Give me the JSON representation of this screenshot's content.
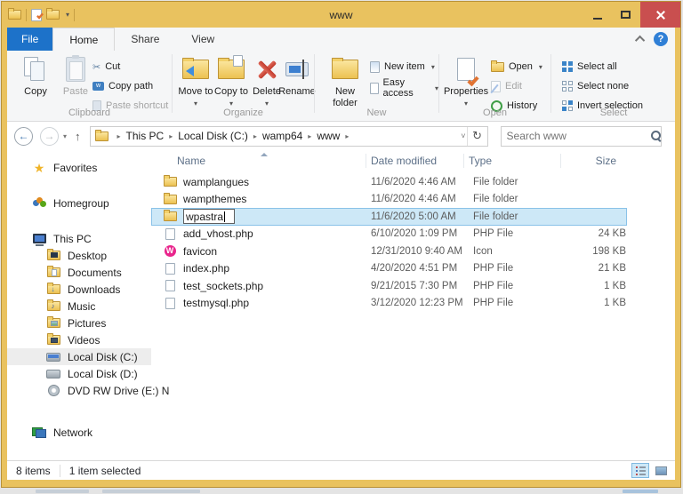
{
  "window": {
    "title": "www",
    "tabs": {
      "file": "File",
      "home": "Home",
      "share": "Share",
      "view": "View"
    }
  },
  "colors": {
    "titlebar_gold": "#e9c25f",
    "file_tab_blue": "#1d72c9",
    "selection_fill": "#cde8f7",
    "selection_border": "#8ac2e8",
    "close_button_red": "#c94f4f"
  },
  "ribbon": {
    "clipboard": {
      "label": "Clipboard",
      "copy": "Copy",
      "paste": "Paste",
      "cut": "Cut",
      "copy_path": "Copy path",
      "paste_shortcut": "Paste shortcut"
    },
    "organize": {
      "label": "Organize",
      "move_to": "Move to",
      "copy_to": "Copy to",
      "delete": "Delete",
      "rename": "Rename"
    },
    "new_group": {
      "label": "New",
      "new_folder": "New folder",
      "new_item": "New item",
      "easy_access": "Easy access"
    },
    "open_group": {
      "label": "Open",
      "properties": "Properties",
      "open": "Open",
      "edit": "Edit",
      "history": "History"
    },
    "select_group": {
      "label": "Select",
      "select_all": "Select all",
      "select_none": "Select none",
      "invert_selection": "Invert selection"
    }
  },
  "navbar": {
    "breadcrumb": [
      "This PC",
      "Local Disk (C:)",
      "wamp64",
      "www"
    ],
    "search_placeholder": "Search www"
  },
  "sidebar": {
    "items": [
      {
        "label": "Favorites"
      },
      {
        "label": "Homegroup"
      },
      {
        "label": "This PC"
      },
      {
        "label": "Desktop"
      },
      {
        "label": "Documents"
      },
      {
        "label": "Downloads"
      },
      {
        "label": "Music"
      },
      {
        "label": "Pictures"
      },
      {
        "label": "Videos"
      },
      {
        "label": "Local Disk (C:)"
      },
      {
        "label": "Local Disk (D:)"
      },
      {
        "label": "DVD RW Drive (E:) N"
      },
      {
        "label": "Network"
      }
    ]
  },
  "filelist": {
    "columns": {
      "name": "Name",
      "date": "Date modified",
      "type": "Type",
      "size": "Size"
    },
    "rename_value": "wpastra",
    "rows": [
      {
        "name": "wamplangues",
        "date": "11/6/2020 4:46 AM",
        "type": "File folder",
        "size": ""
      },
      {
        "name": "wampthemes",
        "date": "11/6/2020 4:46 AM",
        "type": "File folder",
        "size": ""
      },
      {
        "name": "wpastra",
        "date": "11/6/2020 5:00 AM",
        "type": "File folder",
        "size": ""
      },
      {
        "name": "add_vhost.php",
        "date": "6/10/2020 1:09 PM",
        "type": "PHP File",
        "size": "24 KB"
      },
      {
        "name": "favicon",
        "date": "12/31/2010 9:40 AM",
        "type": "Icon",
        "size": "198 KB"
      },
      {
        "name": "index.php",
        "date": "4/20/2020 4:51 PM",
        "type": "PHP File",
        "size": "21 KB"
      },
      {
        "name": "test_sockets.php",
        "date": "9/21/2015 7:30 PM",
        "type": "PHP File",
        "size": "1 KB"
      },
      {
        "name": "testmysql.php",
        "date": "3/12/2020 12:23 PM",
        "type": "PHP File",
        "size": "1 KB"
      }
    ]
  },
  "statusbar": {
    "items_count": "8 items",
    "selected_count": "1 item selected"
  }
}
